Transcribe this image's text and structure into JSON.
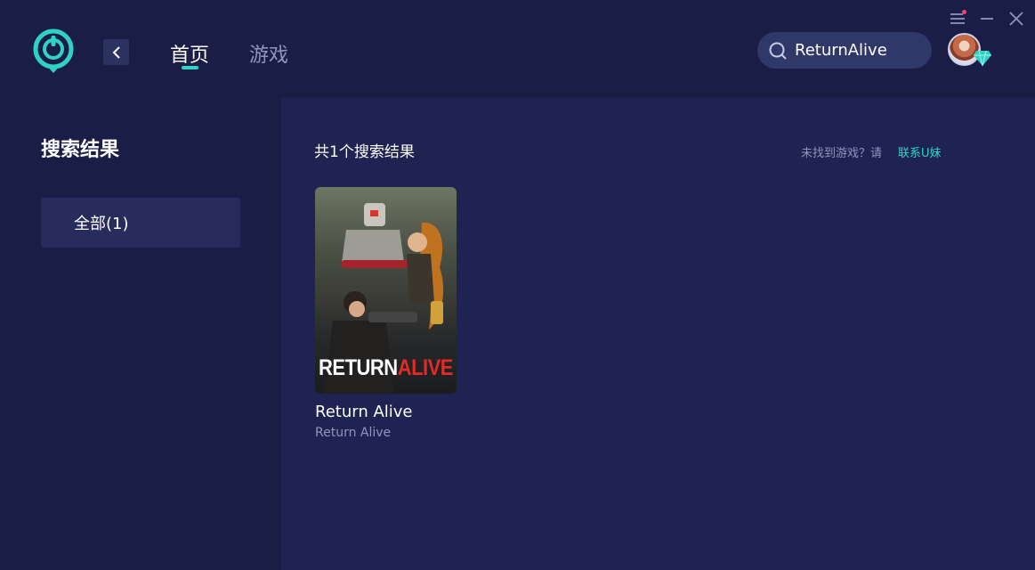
{
  "header": {
    "tabs": [
      {
        "label": "首页",
        "active": true
      },
      {
        "label": "游戏",
        "active": false
      }
    ],
    "search": {
      "value": "ReturnAlive"
    },
    "accent_color": "#2fd3c6"
  },
  "sidebar": {
    "title": "搜索结果",
    "filters": [
      {
        "label": "全部(1)",
        "selected": true
      }
    ]
  },
  "main": {
    "result_count": "共1个搜索结果",
    "not_found_text": "未找到游戏？请",
    "contact_link": "联系U妹",
    "games": [
      {
        "name": "Return Alive",
        "subtitle": "Return Alive",
        "cover_logo_part1": "RETURN",
        "cover_logo_part2": "ALIVE"
      }
    ]
  }
}
